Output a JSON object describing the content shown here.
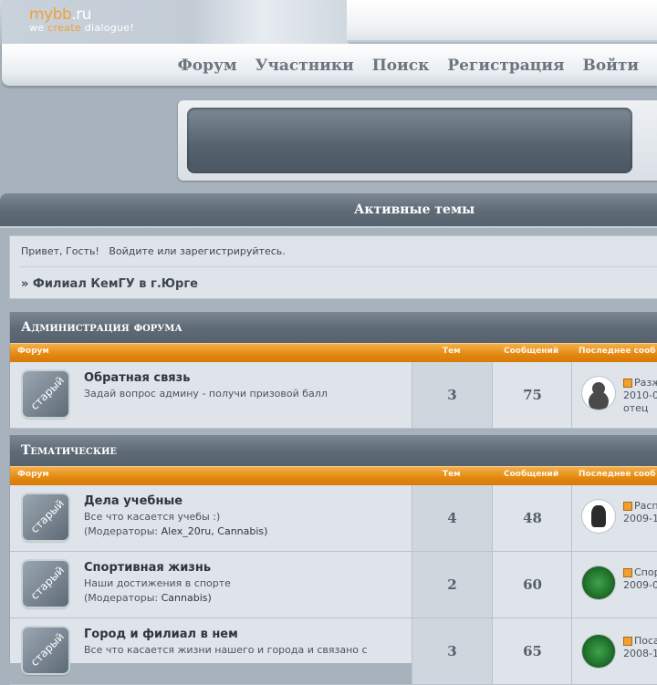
{
  "logo": {
    "brand_orange": "mybb",
    "brand_white": ".ru",
    "slogan_1": "we",
    "slogan_2": "create",
    "slogan_3": "dialogue!"
  },
  "nav": {
    "forum": "Форум",
    "members": "Участники",
    "search": "Поиск",
    "register": "Регистрация",
    "login": "Войти"
  },
  "page_title": "Активные темы",
  "welcome": {
    "greeting": "Привет, Гость!",
    "login_link": "Войдите",
    "or": "или",
    "register_link": "зарегистрируйтесь."
  },
  "breadcrumb": "» Филиал КемГУ в г.Юрге",
  "columns": {
    "forum": "Форум",
    "topics": "Тем",
    "posts": "Сообщений",
    "last_post": "Последнее сооб"
  },
  "forum_icon_label": "старый",
  "moderators_label": "(Модераторы:",
  "categories": [
    {
      "title": "Администрация форума",
      "forums": [
        {
          "name": "Обратная связь",
          "desc": "Задай вопрос админу - получи призовой балл",
          "topics": "3",
          "posts": "75",
          "last_title": "Разж",
          "last_date": "2010-0",
          "last_author": "отец"
        }
      ]
    },
    {
      "title": "Тематические",
      "forums": [
        {
          "name": "Дела учебные",
          "desc": "Все что касается учебы :)",
          "moderators": "Alex_20ru, Cannabis)",
          "topics": "4",
          "posts": "48",
          "last_title": "Расп",
          "last_date": "2009-1"
        },
        {
          "name": "Спортивная жизнь",
          "desc": "Наши достижения в спорте",
          "moderators": "Cannabis)",
          "topics": "2",
          "posts": "60",
          "last_title": "Спор",
          "last_date": "2009-0"
        },
        {
          "name": "Город и филиал в нем",
          "desc": "Все что касается жизни нашего и города и связано с",
          "topics": "3",
          "posts": "65",
          "last_title": "Поса",
          "last_date": "2008-1"
        }
      ]
    }
  ],
  "colors": {
    "accent_orange": "#e3870f",
    "header_dark": "#5e6a75",
    "bg": "#a7b2bd"
  }
}
